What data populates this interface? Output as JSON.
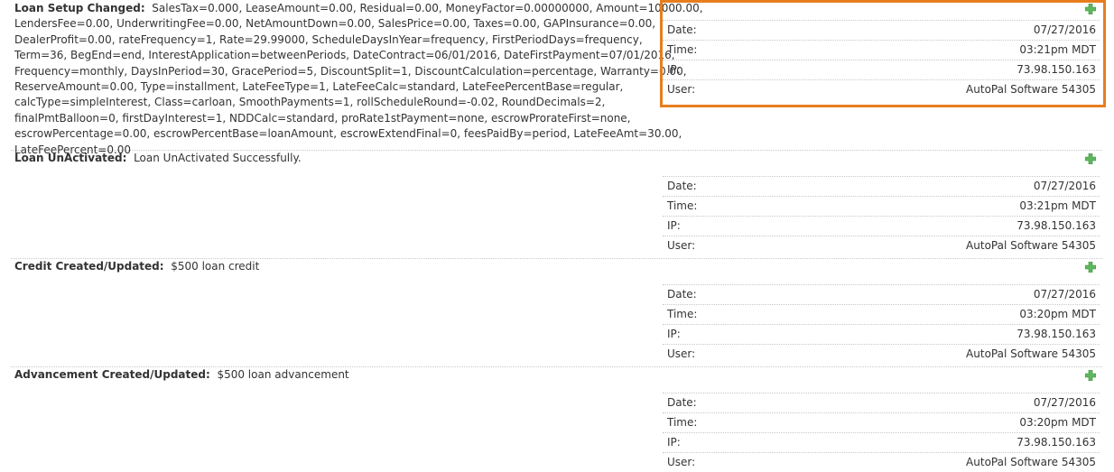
{
  "entries": [
    {
      "title": "Loan Setup Changed:",
      "lines": [
        "SalesTax=0.000, LeaseAmount=0.00, Residual=0.00, MoneyFactor=0.00000000, Amount=10000.00,",
        "LendersFee=0.00, UnderwritingFee=0.00, NetAmountDown=0.00, SalesPrice=0.00, Taxes=0.00, GAPInsurance=0.00,",
        "DealerProfit=0.00, rateFrequency=1, Rate=29.99000, ScheduleDaysInYear=frequency, FirstPeriodDays=frequency,",
        "Term=36, BegEnd=end, InterestApplication=betweenPeriods, DateContract=06/01/2016, DateFirstPayment=07/01/2016,",
        "Frequency=monthly, DaysInPeriod=30, GracePeriod=5, DiscountSplit=1, DiscountCalculation=percentage, Warranty=0.00,",
        "ReserveAmount=0.00, Type=installment, LateFeeType=1, LateFeeCalc=standard, LateFeePercentBase=regular,",
        "calcType=simpleInterest, Class=carloan, SmoothPayments=1, rollScheduleRound=-0.02, RoundDecimals=2,",
        "finalPmtBalloon=0, firstDayInterest=1, NDDCalc=standard, proRate1stPayment=none, escrowProrateFirst=none,",
        "escrowPercentage=0.00, escrowPercentBase=loanAmount, escrowExtendFinal=0, feesPaidBy=period, LateFeeAmt=30.00,",
        "LateFeePercent=0.00"
      ],
      "date": "07/27/2016",
      "time": "03:21pm MDT",
      "ip": "73.98.150.163",
      "user": "AutoPal Software 54305"
    },
    {
      "title": "Loan UnActivated:",
      "lines": [
        "Loan UnActivated Successfully."
      ],
      "date": "07/27/2016",
      "time": "03:21pm MDT",
      "ip": "73.98.150.163",
      "user": "AutoPal Software 54305"
    },
    {
      "title": "Credit Created/Updated:",
      "lines": [
        "$500 loan credit"
      ],
      "date": "07/27/2016",
      "time": "03:20pm MDT",
      "ip": "73.98.150.163",
      "user": "AutoPal Software 54305"
    },
    {
      "title": "Advancement Created/Updated:",
      "lines": [
        "$500 loan advancement"
      ],
      "date": "07/27/2016",
      "time": "03:20pm MDT",
      "ip": "73.98.150.163",
      "user": "AutoPal Software 54305"
    }
  ],
  "labels": {
    "date": "Date:",
    "time": "Time:",
    "ip": "IP:",
    "user": "User:"
  },
  "icons": {
    "add": "plus-icon"
  },
  "colors": {
    "add_icon": "#5cb85c",
    "highlight": "#e87d1e"
  }
}
